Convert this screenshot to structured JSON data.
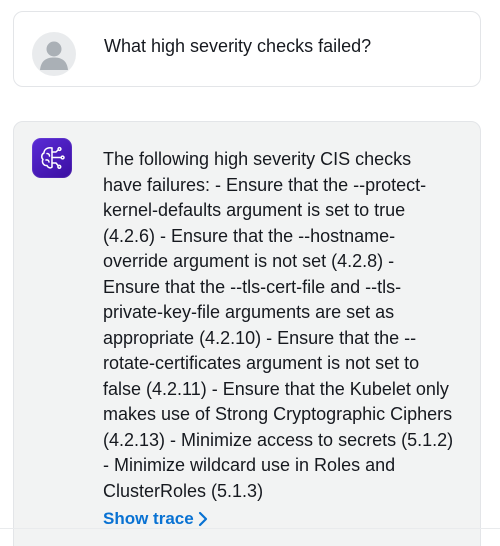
{
  "conversation": {
    "user_message": {
      "avatar_icon": "user-avatar-icon",
      "text": "What high severity checks failed?"
    },
    "assistant_message": {
      "avatar_icon": "ai-brain-icon",
      "text": "The following high severity CIS checks have failures: - Ensure that the --protect-kernel-defaults argument is set to true (4.2.6) - Ensure that the --hostname-override argument is not set (4.2.8) - Ensure that the --tls-cert-file and --tls-private-key-file arguments are set as appropriate (4.2.10) - Ensure that the --rotate-certificates argument is not set to false (4.2.11) - Ensure that the Kubelet only makes use of Strong Cryptographic Ciphers (4.2.13) - Minimize access to secrets (5.1.2) - Minimize wildcard use in Roles and ClusterRoles (5.1.3)",
      "show_trace_label": "Show trace",
      "show_trace_icon": "chevron-right-icon"
    }
  },
  "colors": {
    "link": "#0972d3",
    "assistant_bg": "#f2f3f3",
    "avatar_purple": "#4a1bbf"
  }
}
